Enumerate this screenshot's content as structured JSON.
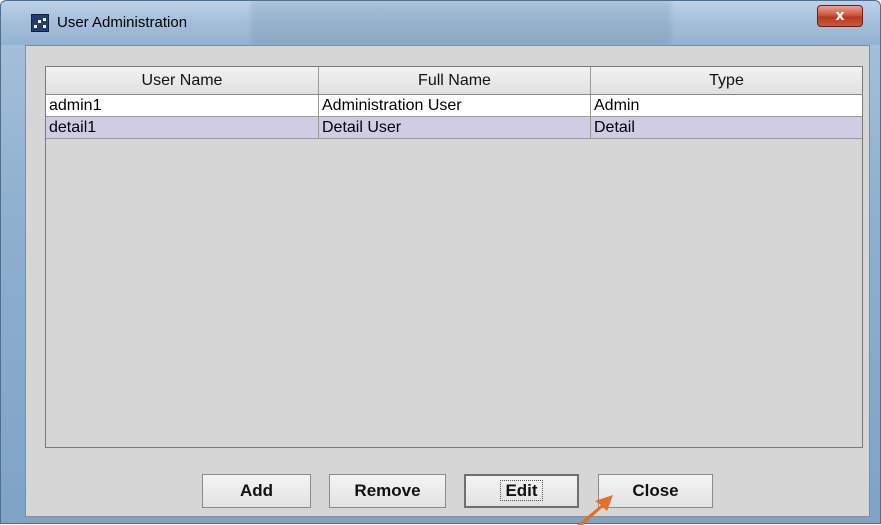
{
  "window": {
    "title": "User Administration",
    "close_label": "x",
    "icon": "app-dots-icon"
  },
  "table": {
    "columns": [
      "User Name",
      "Full Name",
      "Type"
    ],
    "rows": [
      {
        "user_name": "admin1",
        "full_name": "Administration User",
        "type": "Admin",
        "selected": false
      },
      {
        "user_name": "detail1",
        "full_name": "Detail User",
        "type": "Detail",
        "selected": true
      }
    ]
  },
  "buttons": {
    "add": "Add",
    "remove": "Remove",
    "edit": "Edit",
    "close": "Close"
  },
  "colors": {
    "selected_row": "#cfcde6",
    "panel": "#d6d6d6",
    "close_button": "#c94a30",
    "pointer_arrow": "#e0712a"
  }
}
